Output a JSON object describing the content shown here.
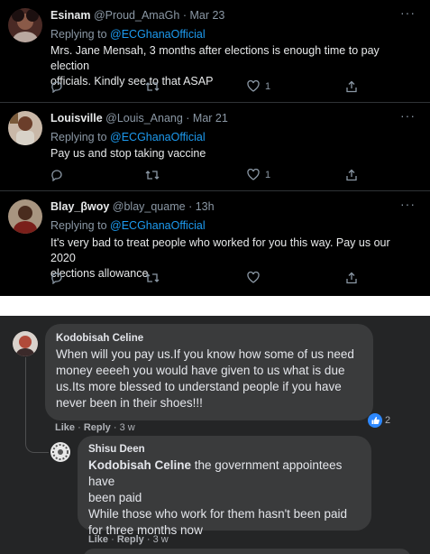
{
  "twitter": {
    "tweets": [
      {
        "name": "Esinam",
        "handle": "@Proud_AmaGh",
        "date": "· Mar 23",
        "replying_prefix": "Replying to",
        "replying_to": "@ECGhanaOfficial",
        "lines": [
          "Mrs. Jane Mensah, 3 months after elections is enough time  to pay election",
          "officials. Kindly see to that ASAP"
        ],
        "like_count": "1"
      },
      {
        "name": "Louisville",
        "handle": "@Louis_Anang",
        "date": "· Mar 21",
        "replying_prefix": "Replying to",
        "replying_to": "@ECGhanaOfficial",
        "lines": [
          "Pay us and stop taking vaccine"
        ],
        "like_count": "1"
      },
      {
        "name": "Blay_βwoy",
        "handle": "@blay_quame",
        "date": "· 13h",
        "replying_prefix": "Replying to",
        "replying_to": "@ECGhanaOfficial",
        "lines": [
          "It's very bad to treat people who worked for you this way. Pay us our 2020",
          "elections allowance"
        ],
        "like_count": ""
      }
    ],
    "more_label": "···",
    "icons": [
      "reply-icon",
      "retweet-icon",
      "like-icon",
      "share-icon"
    ]
  },
  "facebook": {
    "comment": {
      "author": "Kodobisah Celine",
      "lines": [
        "When will you pay us.If you know how some of us need",
        "money eeeeh you would have given to us what is due",
        "us.Its more blessed to understand people if you have",
        "never been in their shoes!!!"
      ],
      "like_label": "Like",
      "reply_label": "Reply",
      "time": "3 w",
      "reaction_count": "2"
    },
    "reply": {
      "author": "Shisu Deen",
      "tag": "Kodobisah Celine",
      "lines": [
        "the government appointees have",
        "been paid",
        "While those who work for them hasn't been paid",
        "for three months now"
      ],
      "like_label": "Like",
      "reply_label": "Reply",
      "time": "3 w"
    },
    "colors": {
      "bubble": "#3a3b3c",
      "background": "#242526",
      "like_blue": "#2d88ff"
    }
  }
}
